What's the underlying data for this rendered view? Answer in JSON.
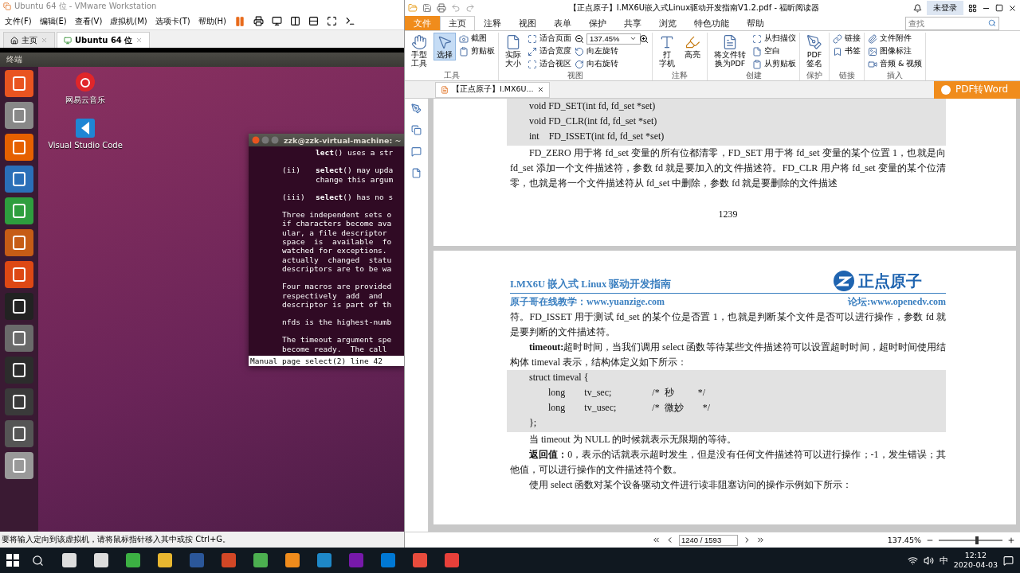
{
  "vmware": {
    "title": "Ubuntu 64 位 - VMware Workstation",
    "menu": [
      "文件(F)",
      "编辑(E)",
      "查看(V)",
      "虚拟机(M)",
      "选项卡(T)",
      "帮助(H)"
    ],
    "tabs": [
      {
        "label": "主页",
        "selected": false
      },
      {
        "label": "Ubuntu 64 位",
        "selected": true
      }
    ],
    "guest": {
      "top_bar": "终端",
      "desktop_icons": [
        {
          "kind": "music",
          "label": "网易云音乐"
        },
        {
          "kind": "code",
          "label": "Visual Studio Code"
        }
      ],
      "terminal": {
        "title": "zzk@zzk-virtual-machine: ~",
        "paragraphs": [
          [
            {
              "kind": "cont",
              "text": "**lect**() uses a str"
            }
          ],
          [
            {
              "kind": "item",
              "label": "(ii)",
              "text": "**select**() may upda"
            },
            {
              "kind": "cont",
              "text": "change this argum"
            }
          ],
          [
            {
              "kind": "item",
              "label": "(iii)",
              "text": "**select**() has no s"
            }
          ],
          [
            {
              "kind": "text",
              "text": "Three independent sets o"
            },
            {
              "kind": "text",
              "text": "if characters become ava"
            },
            {
              "kind": "text",
              "text": "ular, a file descriptor"
            },
            {
              "kind": "text",
              "text": "space  is  available  fo"
            },
            {
              "kind": "text",
              "text": "watched for exceptions."
            },
            {
              "kind": "text",
              "text": "actually  changed  statu"
            },
            {
              "kind": "text",
              "text": "descriptors are to be wa"
            }
          ],
          [
            {
              "kind": "text",
              "text": "Four macros are provided"
            },
            {
              "kind": "text",
              "text": "respectively  add  and"
            },
            {
              "kind": "text",
              "text": "descriptor is part of th"
            }
          ],
          [
            {
              "kind": "text",
              "text": "nfds is the highest-numb"
            }
          ],
          [
            {
              "kind": "text",
              "text": "The timeout argument spe"
            },
            {
              "kind": "text",
              "text": "become ready.  The call"
            }
          ]
        ],
        "status": "Manual page select(2) line 42"
      }
    },
    "status_bar": "要将输入定向到该虚拟机，请将鼠标指针移入其中或按 Ctrl+G。"
  },
  "reader": {
    "title": "【正点原子】I.MX6U嵌入式Linux驱动开发指南V1.2.pdf - 福昕阅读器",
    "login": "未登录",
    "tabs": [
      {
        "label": "文件",
        "kind": "file",
        "selected": false
      },
      {
        "label": "主页",
        "kind": "tab",
        "selected": true
      },
      {
        "label": "注释",
        "kind": "tab",
        "selected": false
      },
      {
        "label": "视图",
        "kind": "tab",
        "selected": false
      },
      {
        "label": "表单",
        "kind": "tab",
        "selected": false
      },
      {
        "label": "保护",
        "kind": "tab",
        "selected": false
      },
      {
        "label": "共享",
        "kind": "tab",
        "selected": false
      },
      {
        "label": "浏览",
        "kind": "tab",
        "selected": false
      },
      {
        "label": "特色功能",
        "kind": "tab",
        "selected": false
      },
      {
        "label": "帮助",
        "kind": "tab",
        "selected": false
      }
    ],
    "search": {
      "placeholder": "查找"
    },
    "ribbon": [
      {
        "name": "工具",
        "columns": [
          {
            "kind": "large",
            "lines": [
              "手型",
              "工具"
            ],
            "selected": false
          },
          {
            "kind": "large",
            "lines": [
              "选择"
            ],
            "selected": true
          },
          {
            "kind": "stack",
            "items": [
              {
                "kind": "button",
                "label": "截图"
              },
              {
                "kind": "button",
                "label": "剪贴板"
              }
            ]
          }
        ]
      },
      {
        "name": "视图",
        "columns": [
          {
            "kind": "large",
            "lines": [
              "实际",
              "大小"
            ],
            "selected": false
          },
          {
            "kind": "stack",
            "items": [
              {
                "kind": "button",
                "label": "适合页面"
              },
              {
                "kind": "button",
                "label": "适合宽度"
              },
              {
                "kind": "button",
                "label": "适合视区"
              }
            ]
          },
          {
            "kind": "stack",
            "items": [
              {
                "kind": "zoom",
                "value": "137.45%"
              },
              {
                "kind": "button",
                "label": "向左旋转"
              },
              {
                "kind": "button",
                "label": "向右旋转"
              }
            ]
          }
        ]
      },
      {
        "name": "注释",
        "columns": [
          {
            "kind": "large",
            "lines": [
              "打",
              "字机"
            ],
            "selected": false
          },
          {
            "kind": "large",
            "lines": [
              "高亮"
            ],
            "selected": false
          }
        ]
      },
      {
        "name": "创建",
        "columns": [
          {
            "kind": "large",
            "lines": [
              "将文件转",
              "换为PDF"
            ],
            "selected": false
          },
          {
            "kind": "stack",
            "items": [
              {
                "kind": "button",
                "label": "从扫描仪"
              },
              {
                "kind": "button",
                "label": "空白"
              },
              {
                "kind": "button",
                "label": "从剪贴板"
              }
            ]
          }
        ]
      },
      {
        "name": "保护",
        "columns": [
          {
            "kind": "large",
            "lines": [
              "PDF",
              "签名"
            ],
            "selected": false
          }
        ]
      },
      {
        "name": "链接",
        "columns": [
          {
            "kind": "stack",
            "items": [
              {
                "kind": "button",
                "label": "链接"
              },
              {
                "kind": "button",
                "label": "书签"
              }
            ]
          }
        ]
      },
      {
        "name": "插入",
        "columns": [
          {
            "kind": "stack",
            "items": [
              {
                "kind": "button",
                "label": "文件附件"
              },
              {
                "kind": "button",
                "label": "图像标注"
              },
              {
                "kind": "button",
                "label": "音频 & 视频"
              }
            ]
          }
        ]
      }
    ],
    "doc_tabs": [
      {
        "label": "【正点原子】I.MX6U...",
        "selected": true
      }
    ],
    "convert_button": "PDF转Word",
    "page1": {
      "code": [
        "void FD_SET(int fd, fd_set *set)",
        "void FD_CLR(int fd, fd_set *set)",
        "int    FD_ISSET(int fd, fd_set *set)"
      ],
      "paragraph": "FD_ZERO 用于将 fd_set 变量的所有位都清零，FD_SET 用于将 fd_set 变量的某个位置 1，也就是向 fd_set 添加一个文件描述符，参数 fd 就是要加入的文件描述符。FD_CLR 用户将 fd_set 变量的某个位清零，也就是将一个文件描述符从 fd_set 中删除，参数 fd 就是要删除的文件描述",
      "page_number": "1239"
    },
    "page2": {
      "header_title": "I.MX6U 嵌入式 Linux 驱动开发指南",
      "logo": "正点原子",
      "header_left": "原子哥在线教学：www.yuanzige.com",
      "header_right": "论坛:www.openedv.com",
      "blocks": [
        {
          "kind": "text",
          "indent": false,
          "text": "符。FD_ISSET 用于测试 fd_set 的某个位是否置 1，也就是判断某个文件是否可以进行操作，参数 fd 就是要判断的文件描述符。"
        },
        {
          "kind": "text",
          "indent": true,
          "text": "**timeout:**超时时间，当我们调用 select 函数等待某些文件描述符可以设置超时时间，超时时间使用结构体 timeval 表示，结构体定义如下所示："
        },
        {
          "kind": "code",
          "lines": [
            "struct timeval {",
            "        long        tv_sec;                 /*  秒          */",
            "        long        tv_usec;               /*  微妙        */",
            "};"
          ]
        },
        {
          "kind": "text",
          "indent": true,
          "text": "当 timeout 为 NULL 的时候就表示无限期的等待。"
        },
        {
          "kind": "text",
          "indent": true,
          "text": "**返回值：**0，表示的话就表示超时发生，但是没有任何文件描述符可以进行操作；-1，发生错误；其他值，可以进行操作的文件描述符个数。"
        },
        {
          "kind": "text",
          "indent": true,
          "text": "使用 select 函数对某个设备驱动文件进行读非阻塞访问的操作示例如下所示："
        }
      ]
    },
    "status": {
      "page": "1240 / 1593",
      "zoom": "137.45%",
      "zoom_slider": {
        "level": 0.6
      }
    }
  },
  "taskbar": {
    "ime": "中",
    "time": "12:12",
    "date": "2020-04-03"
  }
}
